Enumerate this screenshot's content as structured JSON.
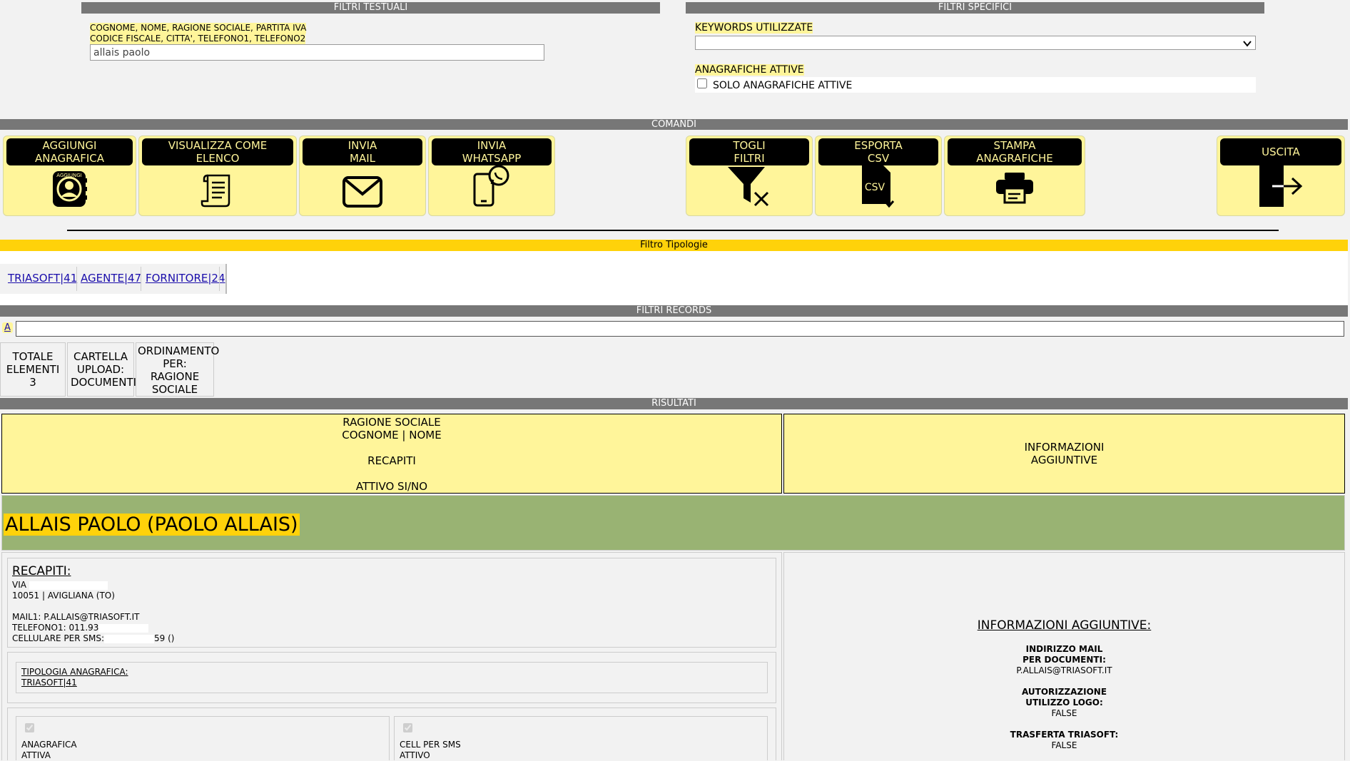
{
  "filtri_testuali": {
    "title": "FILTRI TESTUALI",
    "hint_line1": "COGNOME, NOME, RAGIONE SOCIALE, PARTITA IVA",
    "hint_line2": "CODICE FISCALE, CITTA', TELEFONO1, TELEFONO2",
    "search_value": "allais paolo"
  },
  "filtri_specifici": {
    "title": "FILTRI SPECIFICI",
    "keywords_label": "KEYWORDS UTILIZZATE",
    "keywords_selected": "",
    "attive_label": "ANAGRAFICHE ATTIVE",
    "solo_attive_label": "SOLO ANAGRAFICHE ATTIVE",
    "solo_attive_checked": false
  },
  "comandi": {
    "title": "COMANDI",
    "buttons": [
      {
        "line1": "AGGIUNGI",
        "line2": "ANAGRAFICA",
        "icon": "add-contact-icon"
      },
      {
        "line1": "VISUALIZZA COME",
        "line2": "ELENCO",
        "icon": "list-scroll-icon"
      },
      {
        "line1": "INVIA",
        "line2": "MAIL",
        "icon": "mail-icon"
      },
      {
        "line1": "INVIA",
        "line2": "WHATSAPP",
        "icon": "whatsapp-phone-icon"
      },
      {
        "line1": "TOGLI",
        "line2": "FILTRI",
        "icon": "clear-filter-icon"
      },
      {
        "line1": "ESPORTA",
        "line2": "CSV",
        "icon": "csv-export-icon"
      },
      {
        "line1": "STAMPA",
        "line2": "ANAGRAFICHE",
        "icon": "printer-icon"
      },
      {
        "line1": "",
        "line2": "USCITA",
        "icon": "exit-icon"
      }
    ],
    "icon_add_label": "AGGIUNGI",
    "icon_csv_label": "CSV"
  },
  "filtro_tipologie": {
    "title": "Filtro Tipologie",
    "items": [
      "TRIASOFT|41",
      "AGENTE|47",
      "FORNITORE|24"
    ]
  },
  "filtri_records": {
    "title": "FILTRI RECORDS",
    "letter": "A",
    "input_value": ""
  },
  "info_cells": [
    {
      "text": "TOTALE ELEMENTI 3"
    },
    {
      "text": "CARTELLA UPLOAD: DOCUMENTI"
    },
    {
      "text": "ORDINAMENTO PER: RAGIONE SOCIALE"
    }
  ],
  "risultati": {
    "title": "RISULTATI",
    "col1_line1": "RAGIONE SOCIALE",
    "col1_line2": "COGNOME | NOME",
    "col1_line3": "RECAPITI",
    "col1_line4": "ATTIVO SI/NO",
    "col2_line1": "INFORMAZIONI",
    "col2_line2": "AGGIUNTIVE"
  },
  "record": {
    "name": "ALLAIS PAOLO (PAOLO ALLAIS)",
    "recapiti_title": "RECAPITI:",
    "address1": "VIA ",
    "address2": "10051 | AVIGLIANA (TO)",
    "mail1": "MAIL1: P.ALLAIS@TRIASOFT.IT",
    "telefono1": "TELEFONO1: 011.93",
    "cellulare_prefix": "CELLULARE PER SMS:",
    "cellulare_suffix": "59 ()",
    "tipologia_label": "TIPOLOGIA ANAGRAFICA:",
    "tipologia_value": "TRIASOFT|41",
    "check1_line1": "ANAGRAFICA",
    "check1_line2": "ATTIVA",
    "check2_line1": "CELL PER SMS",
    "check2_line2": "ATTIVO",
    "info_title": "INFORMAZIONI AGGIUNTIVE:",
    "info_mail_label1": "INDIRIZZO MAIL",
    "info_mail_label2": "PER DOCUMENTI:",
    "info_mail_value": "P.ALLAIS@TRIASOFT.IT",
    "info_logo_label1": "AUTORIZZAZIONE",
    "info_logo_label2": "UTILIZZO LOGO:",
    "info_logo_value": "FALSE",
    "info_transfer_label": "TRASFERTA TRIASOFT:",
    "info_transfer_value": "FALSE"
  }
}
